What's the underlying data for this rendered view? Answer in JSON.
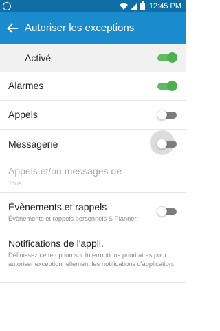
{
  "status_bar": {
    "time": "12:45 PM"
  },
  "header": {
    "title": "Autoriser les exceptions"
  },
  "master": {
    "label": "Activé",
    "enabled": true
  },
  "rows": [
    {
      "label": "Alarmes",
      "toggle": true
    },
    {
      "label": "Appels",
      "toggle": false
    },
    {
      "label": "Messagerie",
      "toggle": false
    },
    {
      "label": "Appels et/ou messages de",
      "sub": "Tous",
      "disabled": true
    },
    {
      "label": "Évènements et rappels",
      "sub": "Évènements et rappels personnels S Planner.",
      "toggle": false
    },
    {
      "label": "Notifications de l'appli.",
      "sub": "Définissez cette option sur Interruptions prioritaires pour autoriser exceptionnellement les notifications d'application."
    }
  ],
  "colors": {
    "status_bar": "#0f6fa4",
    "app_bar": "#1a8ccd",
    "toggle_on": "#4caf50",
    "toggle_off": "#7c7c7c"
  }
}
